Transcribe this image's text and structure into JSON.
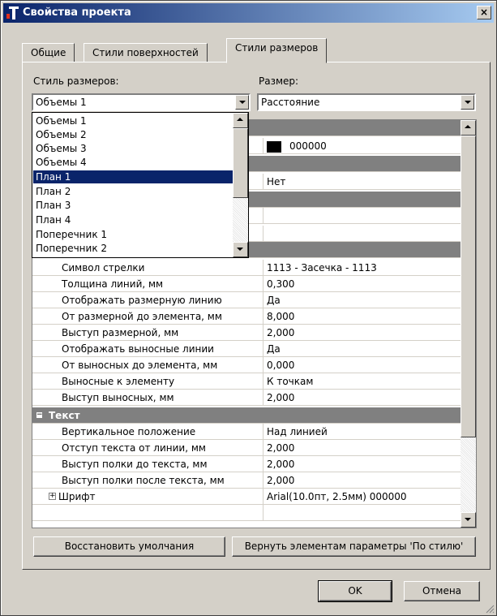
{
  "window": {
    "title": "Свойства проекта",
    "close_glyph": "×"
  },
  "tabs": [
    {
      "label": "Общие",
      "active": false
    },
    {
      "label": "Стили поверхностей",
      "active": false
    },
    {
      "label": "Стили размеров",
      "active": true
    }
  ],
  "style_label": "Стиль размеров:",
  "size_label": "Размер:",
  "style_combo": {
    "value": "Объемы 1"
  },
  "size_combo": {
    "value": "Расстояние"
  },
  "dropdown": {
    "items": [
      "Объемы 1",
      "Объемы 2",
      "Объемы 3",
      "Объемы 4",
      "План 1",
      "План 2",
      "План 3",
      "План 4",
      "Поперечник 1",
      "Поперечник 2"
    ],
    "selected": "План 1"
  },
  "partial_rows": {
    "color_value": "000000",
    "yes_no_value": "Нет"
  },
  "properties": [
    {
      "name": "Символ стрелки",
      "value": "1113 - Засечка - 1113"
    },
    {
      "name": "Толщина линий, мм",
      "value": "0,300"
    },
    {
      "name": "Отображать размерную линию",
      "value": "Да"
    },
    {
      "name": "От размерной до элемента, мм",
      "value": "8,000"
    },
    {
      "name": "Выступ размерной, мм",
      "value": "2,000"
    },
    {
      "name": "Отображать выносные линии",
      "value": "Да"
    },
    {
      "name": "От выносных до элемента, мм",
      "value": "0,000"
    },
    {
      "name": "Выносные к элементу",
      "value": "К точкам"
    },
    {
      "name": "Выступ выносных, мм",
      "value": "2,000"
    }
  ],
  "text_category": {
    "label": "Текст",
    "toggle": "−",
    "rows": [
      {
        "name": "Вертикальное положение",
        "value": "Над линией"
      },
      {
        "name": "Отступ текста от линии, мм",
        "value": "2,000"
      },
      {
        "name": "Выступ полки до текста, мм",
        "value": "2,000"
      },
      {
        "name": "Выступ полки после текста, мм",
        "value": "2,000"
      }
    ],
    "font_row": {
      "toggle": "+",
      "name": "Шрифт",
      "value": "Arial(10.0пт, 2.5мм) 000000"
    }
  },
  "buttons": {
    "restore": "Восстановить умолчания",
    "apply_style": "Вернуть элементам параметры 'По стилю'",
    "ok": "OK",
    "cancel": "Отмена"
  },
  "colors": {
    "titlebar": "#0a246a",
    "selection": "#0a246a",
    "category": "#808080",
    "face": "#d4d0c8"
  }
}
